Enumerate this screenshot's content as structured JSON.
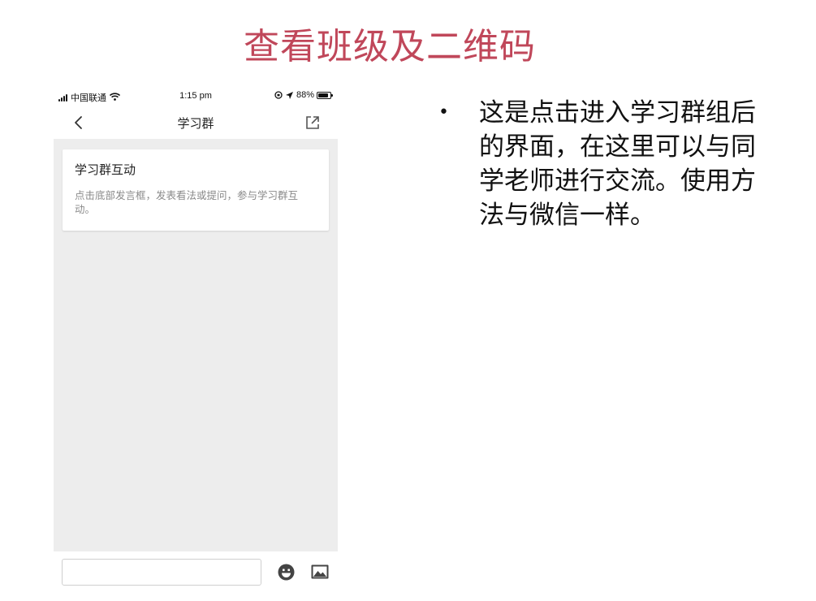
{
  "slide": {
    "title": "查看班级及二维码",
    "bullet_text": "这是点击进入学习群组后的界面，在这里可以与同学老师进行交流。使用方法与微信一样。",
    "title_color": "#c0475a"
  },
  "status_bar": {
    "carrier": "中国联通",
    "time": "1:15 pm",
    "battery": "88%",
    "battery_level": 0.88
  },
  "nav": {
    "title": "学习群",
    "back_icon": "chevron-left-icon",
    "share_icon": "share-external-icon"
  },
  "chat": {
    "background": "#ededed",
    "card": {
      "title": "学习群互动",
      "text": "点击底部发言框，发表看法或提问，参与学习群互动。"
    }
  },
  "input_bar": {
    "input_value": "",
    "input_placeholder": "",
    "emoji_icon": "emoji-icon",
    "image_icon": "image-icon"
  }
}
